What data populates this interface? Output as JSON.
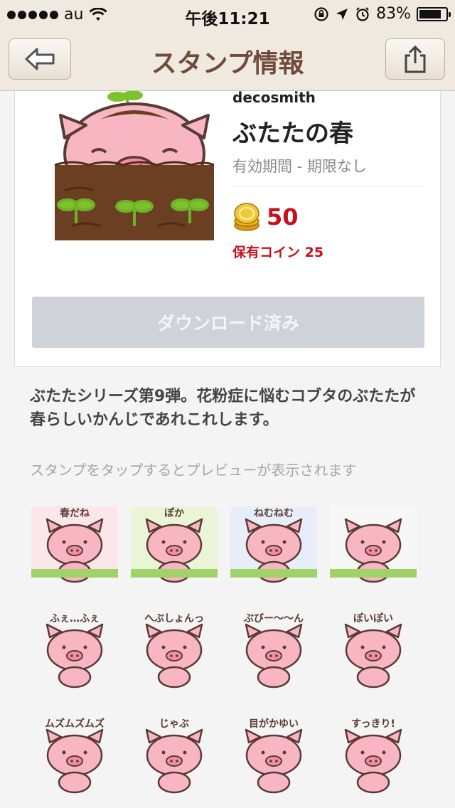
{
  "status_bar": {
    "carrier": "au",
    "time": "午後11:21",
    "battery": "83%",
    "battery_level": 0.83
  },
  "nav": {
    "title": "スタンプ情報",
    "back_icon": "back-arrow-icon",
    "share_icon": "share-icon"
  },
  "stamp": {
    "author": "decosmith",
    "title": "ぶたたの春",
    "validity": "有効期間 - 期限なし",
    "price": "50",
    "owned_label": "保有コイン",
    "owned_coins": "25",
    "download_label": "ダウンロード済み"
  },
  "description": "ぶたたシリーズ第9弾。花粉症に悩むコブタのぶたたが春らしいかんじであれこれします。",
  "hint": "スタンプをタップするとプレビューが表示されます",
  "stickers": [
    {
      "id": "sticker-1",
      "text": "春だね"
    },
    {
      "id": "sticker-2",
      "text": "ぽか"
    },
    {
      "id": "sticker-3",
      "text": "ねむねむ"
    },
    {
      "id": "sticker-4",
      "text": ""
    },
    {
      "id": "sticker-5",
      "text": "ふぇ…ふぇ"
    },
    {
      "id": "sticker-6",
      "text": "へぶしょんっ"
    },
    {
      "id": "sticker-7",
      "text": "ぶびー〜〜ん"
    },
    {
      "id": "sticker-8",
      "text": "ぽいぽい"
    },
    {
      "id": "sticker-9",
      "text": "ムズムズムズ"
    },
    {
      "id": "sticker-10",
      "text": "じゃぶ"
    },
    {
      "id": "sticker-11",
      "text": "目がかゆい"
    },
    {
      "id": "sticker-12",
      "text": "すっきり!"
    }
  ],
  "colors": {
    "nav_bg": "#efe9e0",
    "title_brown": "#6e4b3a",
    "price_red": "#c8101b",
    "pig_pink": "#f7b6c2",
    "pig_outline": "#5a3b33",
    "soil_brown": "#6b3f22",
    "sprout_green": "#7cc22a"
  }
}
